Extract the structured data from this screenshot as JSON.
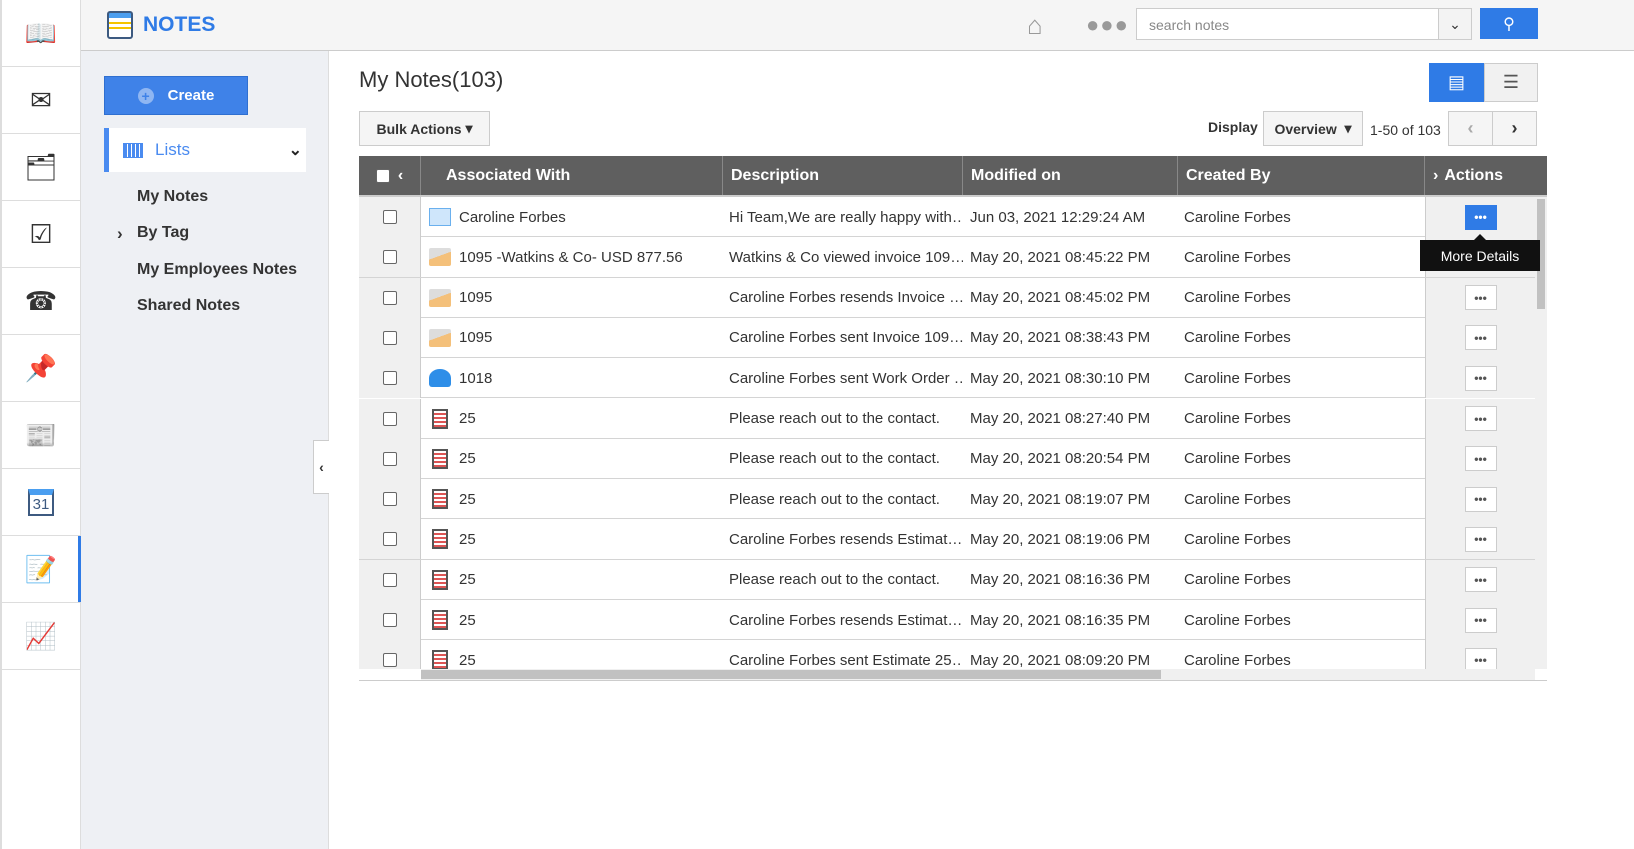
{
  "app": {
    "title": "NOTES"
  },
  "rail": [
    "book-icon",
    "mail-icon",
    "contact-folder-icon",
    "task-calendar-icon",
    "phone-icon",
    "pin-icon",
    "form-icon",
    "calendar-31-icon",
    "notes-icon",
    "chart-icon"
  ],
  "rail_calendar_day": "31",
  "header": {
    "search_placeholder": "search notes"
  },
  "sidebar": {
    "create_label": "Create",
    "lists_label": "Lists",
    "items": [
      {
        "label": "My Notes"
      },
      {
        "label": "By Tag"
      },
      {
        "label": "My Employees Notes"
      },
      {
        "label": "Shared Notes"
      }
    ]
  },
  "main": {
    "title": "My Notes(103)",
    "bulk_label": "Bulk Actions",
    "display_label": "Display",
    "display_value": "Overview",
    "range": "1-50 of 103"
  },
  "table": {
    "columns": [
      "Associated With",
      "Description",
      "Modified on",
      "Created By",
      "Actions"
    ],
    "rows": [
      {
        "icon": "contact",
        "assoc": "Caroline Forbes",
        "desc": "Hi Team,We are really happy with…",
        "modified": "Jun 03, 2021 12:29:24 AM",
        "created": "Caroline Forbes"
      },
      {
        "icon": "invoice",
        "assoc": "1095 -Watkins & Co- USD 877.56",
        "desc": "Watkins & Co viewed invoice 109…",
        "modified": "May 20, 2021 08:45:22 PM",
        "created": "Caroline Forbes"
      },
      {
        "icon": "invoice",
        "assoc": "1095",
        "desc": "Caroline Forbes resends Invoice …",
        "modified": "May 20, 2021 08:45:02 PM",
        "created": "Caroline Forbes"
      },
      {
        "icon": "invoice",
        "assoc": "1095",
        "desc": "Caroline Forbes sent Invoice 109…",
        "modified": "May 20, 2021 08:38:43 PM",
        "created": "Caroline Forbes"
      },
      {
        "icon": "work-order",
        "assoc": "1018",
        "desc": "Caroline Forbes sent Work Order …",
        "modified": "May 20, 2021 08:30:10 PM",
        "created": "Caroline Forbes"
      },
      {
        "icon": "estimate",
        "assoc": "25",
        "desc": "Please reach out to the contact.",
        "modified": "May 20, 2021 08:27:40 PM",
        "created": "Caroline Forbes"
      },
      {
        "icon": "estimate",
        "assoc": "25",
        "desc": "Please reach out to the contact.",
        "modified": "May 20, 2021 08:20:54 PM",
        "created": "Caroline Forbes"
      },
      {
        "icon": "estimate",
        "assoc": "25",
        "desc": "Please reach out to the contact.",
        "modified": "May 20, 2021 08:19:07 PM",
        "created": "Caroline Forbes"
      },
      {
        "icon": "estimate",
        "assoc": "25",
        "desc": "Caroline Forbes resends Estimat…",
        "modified": "May 20, 2021 08:19:06 PM",
        "created": "Caroline Forbes"
      },
      {
        "icon": "estimate",
        "assoc": "25",
        "desc": "Please reach out to the contact.",
        "modified": "May 20, 2021 08:16:36 PM",
        "created": "Caroline Forbes"
      },
      {
        "icon": "estimate",
        "assoc": "25",
        "desc": "Caroline Forbes resends Estimat…",
        "modified": "May 20, 2021 08:16:35 PM",
        "created": "Caroline Forbes"
      },
      {
        "icon": "estimate",
        "assoc": "25",
        "desc": "Caroline Forbes sent Estimate 25…",
        "modified": "May 20, 2021 08:09:20 PM",
        "created": "Caroline Forbes"
      }
    ]
  },
  "tooltip": "More Details",
  "colors": {
    "accent": "#2f7be6",
    "header_bg": "#5f5f5f"
  }
}
